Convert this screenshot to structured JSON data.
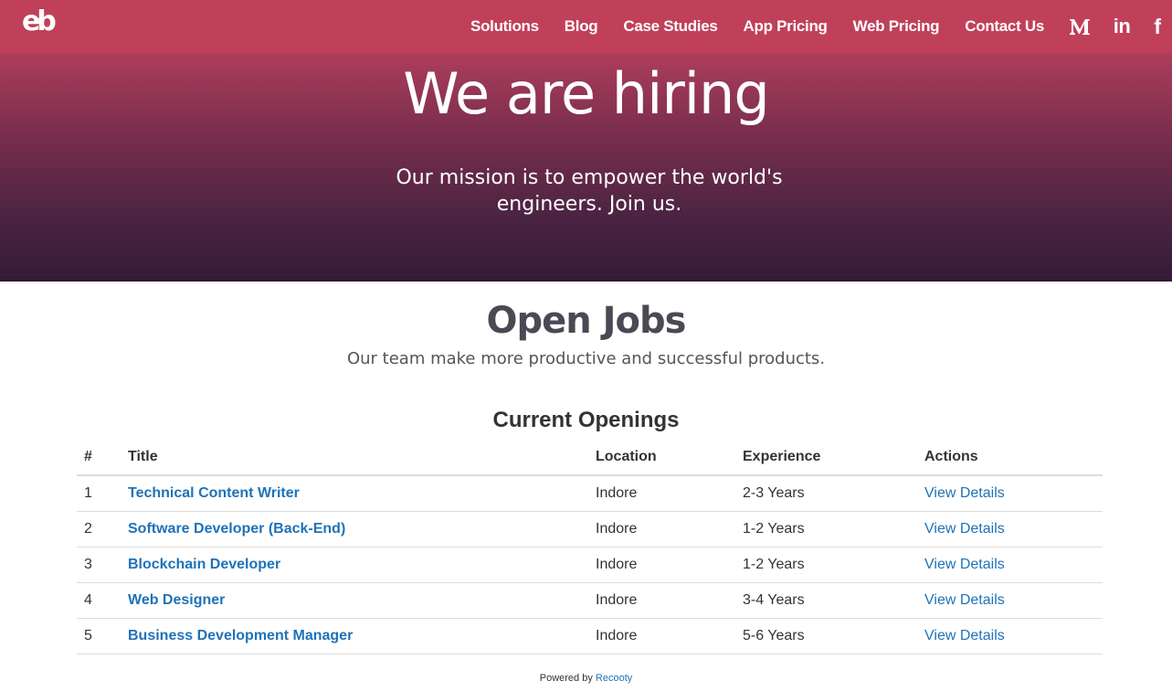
{
  "nav": {
    "logo_text": "eb",
    "links": [
      "Solutions",
      "Blog",
      "Case Studies",
      "App Pricing",
      "Web Pricing",
      "Contact Us"
    ],
    "social": [
      {
        "icon": "medium-icon"
      },
      {
        "icon": "linkedin-icon",
        "glyph": "in"
      },
      {
        "icon": "facebook-icon",
        "glyph": "f"
      }
    ]
  },
  "hero": {
    "title": "We are hiring",
    "subtitle": "Our mission is to empower the world's engineers. Join us."
  },
  "section": {
    "title": "Open Jobs",
    "subtitle": "Our team make more productive and successful products."
  },
  "openings": {
    "title": "Current Openings",
    "columns": [
      "#",
      "Title",
      "Location",
      "Experience",
      "Actions"
    ],
    "rows": [
      {
        "num": "1",
        "title": "Technical Content Writer",
        "location": "Indore",
        "experience": "2-3 Years",
        "action": "View Details"
      },
      {
        "num": "2",
        "title": "Software Developer (Back-End)",
        "location": "Indore",
        "experience": "1-2 Years",
        "action": "View Details"
      },
      {
        "num": "3",
        "title": "Blockchain Developer",
        "location": "Indore",
        "experience": "1-2 Years",
        "action": "View Details"
      },
      {
        "num": "4",
        "title": "Web Designer",
        "location": "Indore",
        "experience": "3-4 Years",
        "action": "View Details"
      },
      {
        "num": "5",
        "title": "Business Development Manager",
        "location": "Indore",
        "experience": "5-6 Years",
        "action": "View Details"
      }
    ]
  },
  "footer": {
    "powered_prefix": "Powered by",
    "powered_link": "Recooty"
  },
  "colors": {
    "navbar": "#c0405a",
    "link": "#1f72b8"
  }
}
